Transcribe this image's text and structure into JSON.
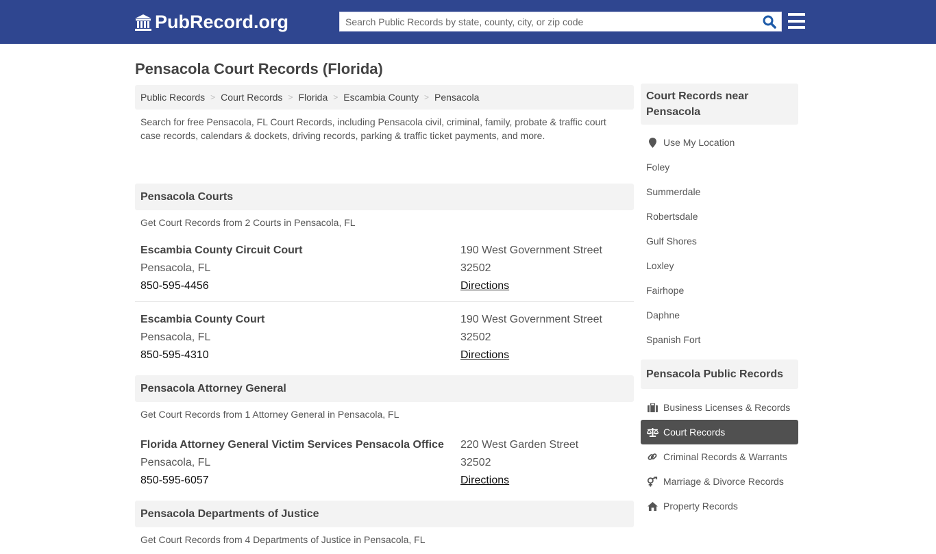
{
  "header": {
    "logo_text": "PubRecord.org",
    "search_placeholder": "Search Public Records by state, county, city, or zip code",
    "colors": {
      "brand": "#2f4690",
      "search_icon": "#1e5ba8"
    }
  },
  "page": {
    "title": "Pensacola Court Records (Florida)",
    "breadcrumb": [
      "Public Records",
      "Court Records",
      "Florida",
      "Escambia County",
      "Pensacola"
    ],
    "intro": "Search for free Pensacola, FL Court Records, including Pensacola civil, criminal, family, probate & traffic court case records, calendars & dockets, driving records, parking & traffic ticket payments, and more."
  },
  "sections": [
    {
      "title": "Pensacola Courts",
      "subtitle": "Get Court Records from 2 Courts in Pensacola, FL",
      "entries": [
        {
          "name": "Escambia County Circuit Court",
          "city": "Pensacola, FL",
          "phone": "850-595-4456",
          "street": "190 West Government Street",
          "zip": "32502",
          "directions": "Directions"
        },
        {
          "name": "Escambia County Court",
          "city": "Pensacola, FL",
          "phone": "850-595-4310",
          "street": "190 West Government Street",
          "zip": "32502",
          "directions": "Directions"
        }
      ]
    },
    {
      "title": "Pensacola Attorney General",
      "subtitle": "Get Court Records from 1 Attorney General in Pensacola, FL",
      "entries": [
        {
          "name": "Florida Attorney General Victim Services Pensacola Office",
          "city": "Pensacola, FL",
          "phone": "850-595-6057",
          "street": "220 West Garden Street",
          "zip": "32502",
          "directions": "Directions"
        }
      ]
    },
    {
      "title": "Pensacola Departments of Justice",
      "subtitle": "Get Court Records from 4 Departments of Justice in Pensacola, FL",
      "entries": []
    }
  ],
  "sidebar": {
    "nearby_title": "Court Records near Pensacola",
    "use_location": "Use My Location",
    "nearby": [
      "Foley",
      "Summerdale",
      "Robertsdale",
      "Gulf Shores",
      "Loxley",
      "Fairhope",
      "Daphne",
      "Spanish Fort"
    ],
    "public_title": "Pensacola Public Records",
    "public_items": [
      {
        "label": "Business Licenses & Records",
        "icon": "briefcase-icon"
      },
      {
        "label": "Court Records",
        "icon": "balance-scale-icon",
        "active": true
      },
      {
        "label": "Criminal Records & Warrants",
        "icon": "link-icon"
      },
      {
        "label": "Marriage & Divorce Records",
        "icon": "gender-icon"
      },
      {
        "label": "Property Records",
        "icon": "home-icon"
      }
    ]
  }
}
